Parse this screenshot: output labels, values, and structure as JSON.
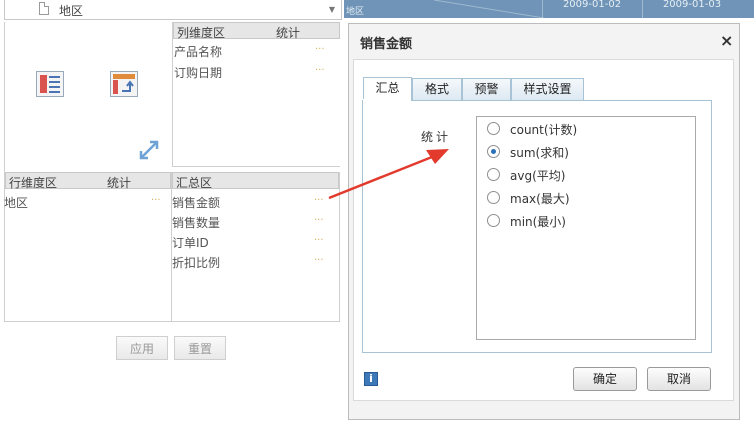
{
  "background": {
    "region_label": "地区",
    "dates": [
      "2009-01-02",
      "2009-01-03"
    ]
  },
  "left_panel": {
    "top_field": {
      "text": "地区"
    },
    "column_area": {
      "title": "列维度区",
      "stat": "统计",
      "items": [
        "产品名称",
        "订购日期"
      ]
    },
    "row_area": {
      "title": "行维度区",
      "stat": "统计",
      "items": [
        "地区"
      ]
    },
    "summary_area": {
      "title": "汇总区",
      "items": [
        "销售金额",
        "销售数量",
        "订单ID",
        "折扣比例"
      ]
    },
    "buttons": {
      "apply": "应用",
      "reset": "重置"
    },
    "more_glyph": "···"
  },
  "dialog": {
    "title": "销售金额",
    "close_glyph": "×",
    "tabs": [
      "汇总",
      "格式",
      "预警",
      "样式设置"
    ],
    "active_tab": 0,
    "stat_label": "统计",
    "options": [
      {
        "label": "count(计数)",
        "selected": false
      },
      {
        "label": "sum(求和)",
        "selected": true
      },
      {
        "label": "avg(平均)",
        "selected": false
      },
      {
        "label": "max(最大)",
        "selected": false
      },
      {
        "label": "min(最小)",
        "selected": false
      }
    ],
    "ok": "确定",
    "cancel": "取消",
    "info_glyph": "i"
  },
  "colors": {
    "accent": "#2a6fb8",
    "arrow": "#e23b2e",
    "tab_border": "#a9c3d6"
  }
}
